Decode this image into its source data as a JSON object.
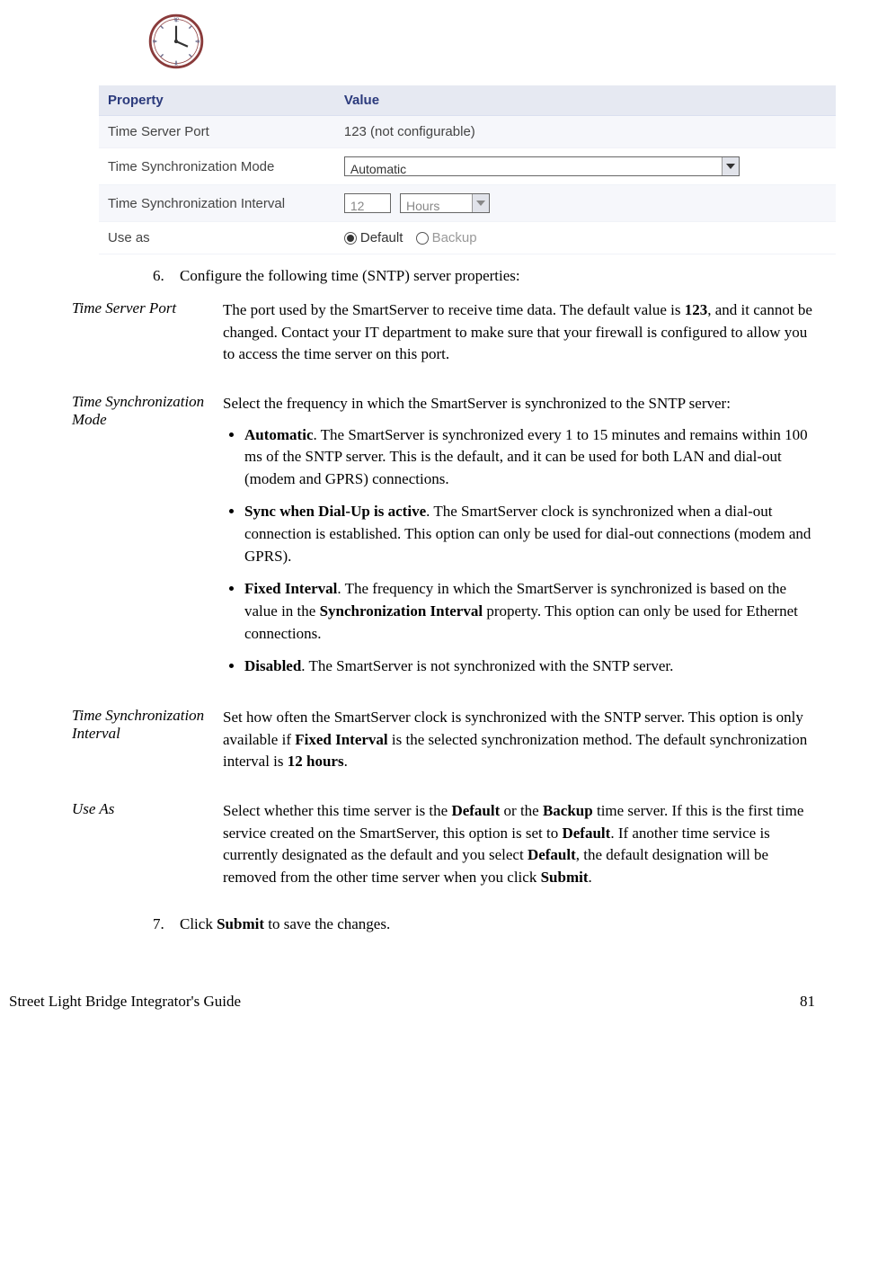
{
  "config_table": {
    "headers": [
      "Property",
      "Value"
    ],
    "rows": {
      "port": {
        "label": "Time Server Port",
        "value": "123 (not configurable)"
      },
      "mode": {
        "label": "Time Synchronization Mode",
        "value": "Automatic"
      },
      "interval": {
        "label": "Time Synchronization Interval",
        "value_num": "12",
        "value_unit": "Hours"
      },
      "useas": {
        "label": "Use as",
        "options": [
          "Default",
          "Backup"
        ],
        "selected": "Default"
      }
    }
  },
  "steps": {
    "s6": {
      "num": "6.",
      "text": "Configure the following time (SNTP) server properties:"
    },
    "s7": {
      "num": "7.",
      "prefix": "Click ",
      "bold": "Submit",
      "suffix": " to save the changes."
    }
  },
  "defs": {
    "port": {
      "term": "Time Server Port",
      "p1a": "The port used by the SmartServer to receive time data.  The default value is ",
      "p1b": "123",
      "p1c": ", and it cannot be changed.  Contact your IT department to make sure that your firewall is configured to allow you to access the time server on this port."
    },
    "mode": {
      "term": "Time Synchronization Mode",
      "intro": "Select the frequency in which the SmartServer is synchronized to the SNTP server:",
      "b1_bold": "Automatic",
      "b1_rest": ".  The SmartServer is synchronized every 1 to 15 minutes and remains within 100 ms of the SNTP server.  This is the default, and it can be used for both LAN and dial-out (modem and GPRS) connections.",
      "b2_bold": "Sync when Dial-Up is active",
      "b2_rest": ".  The SmartServer clock is synchronized when a dial-out connection is established.  This option can only be used for dial-out connections (modem and GPRS).",
      "b3_bold": "Fixed Interval",
      "b3_mid1": ".  The frequency in which the SmartServer is synchronized is based on the value in the ",
      "b3_bold2": "Synchronization Interval",
      "b3_rest": " property.  This option can only be used for Ethernet connections.",
      "b4_bold": "Disabled",
      "b4_rest": ".  The SmartServer is not synchronized with the SNTP server."
    },
    "interval": {
      "term": "Time Synchronization Interval",
      "p_a": "Set how often the SmartServer clock is synchronized with the SNTP server.  This option is only available if ",
      "p_b": "Fixed Interval",
      "p_c": " is the selected synchronization method.  The default synchronization interval is ",
      "p_d": "12 hours",
      "p_e": "."
    },
    "useas": {
      "term": "Use As",
      "p_a": "Select whether this time server is the ",
      "p_b": "Default",
      "p_c": " or the ",
      "p_d": "Backup",
      "p_e": " time server.  If this is the first time service created on the SmartServer, this option is set to ",
      "p_f": "Default",
      "p_g": ".  If another time service is currently designated as the default and you select ",
      "p_h": "Default",
      "p_i": ", the default designation will be removed from the other time server when you click ",
      "p_j": "Submit",
      "p_k": "."
    }
  },
  "footer": {
    "title": "Street Light Bridge Integrator's Guide",
    "page": "81"
  }
}
